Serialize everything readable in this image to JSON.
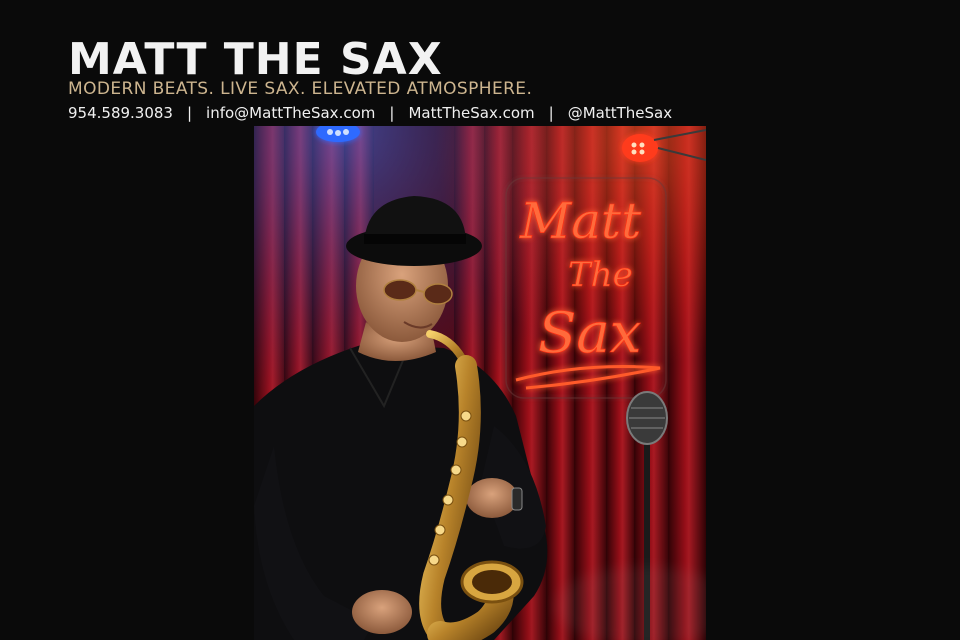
{
  "header": {
    "title": "MATT THE SAX",
    "tagline": "MODERN BEATS. LIVE SAX. ELEVATED ATMOSPHERE.",
    "contact": {
      "phone": "954.589.3083",
      "email": "info@MattTheSax.com",
      "website": "MattTheSax.com",
      "social": "@MattTheSax",
      "separator": "|"
    }
  },
  "photo": {
    "neon_sign": {
      "line1": "Matt",
      "line2": "The",
      "line3": "Sax"
    },
    "icons": [
      "stage-spotlight-icon",
      "saxophone",
      "vintage-microphone-icon",
      "fedora-hat"
    ]
  },
  "colors": {
    "background": "#0a0a0a",
    "title": "#f2f2f2",
    "tagline": "#cdb58f",
    "contact": "#f0f0f0",
    "neon": "#ff4a2a",
    "curtain": "#7a0a12",
    "spotlight_blue": "#3a6cff",
    "spotlight_red": "#ff3a1e"
  }
}
